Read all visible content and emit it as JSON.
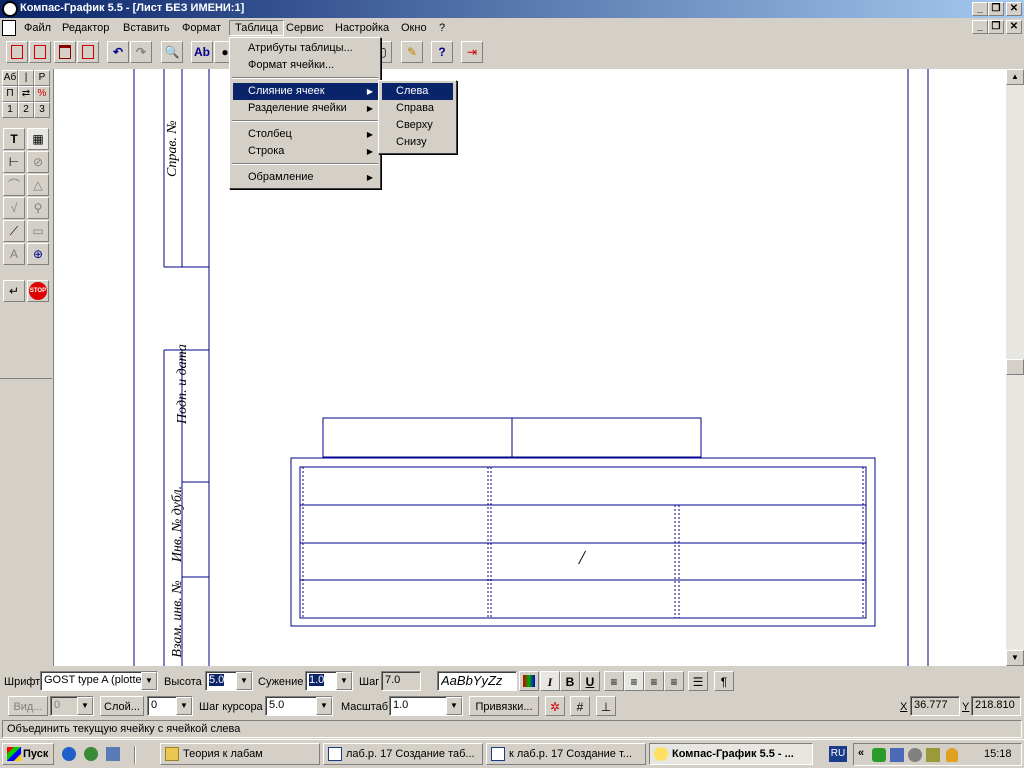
{
  "window": {
    "title": "Компас-График 5.5 - [Лист БЕЗ ИМЕНИ:1]",
    "controls": [
      "_",
      "❐",
      "✕"
    ]
  },
  "menubar": {
    "items": [
      "Файл",
      "Редактор",
      "Вставить",
      "Формат",
      "Таблица",
      "Сервис",
      "Настройка",
      "Окно",
      "?"
    ]
  },
  "table_menu": {
    "items": [
      {
        "label": "Атрибуты таблицы..."
      },
      {
        "label": "Формат ячейки..."
      },
      {
        "label": "Слияние ячеек",
        "submenu": true
      },
      {
        "label": "Разделение ячейки",
        "submenu": true
      },
      {
        "label": "Столбец",
        "submenu": true
      },
      {
        "label": "Строка",
        "submenu": true
      },
      {
        "label": "Обрамление",
        "submenu": true
      }
    ]
  },
  "merge_submenu": {
    "items": [
      "Слева",
      "Справа",
      "Сверху",
      "Снизу"
    ]
  },
  "palette": {
    "row1": [
      "Аб",
      "|↔|",
      "Р"
    ],
    "row2": [
      "П",
      "⇄",
      "%"
    ],
    "row3": [
      "1",
      "2",
      "3"
    ],
    "tools": [
      "T",
      "▦",
      "⊢",
      "⊘",
      "⌒",
      "△",
      "√",
      "⚲",
      "⟋",
      "▭",
      "A",
      "⊕",
      "↵",
      "STOP"
    ]
  },
  "frame_labels": {
    "sprav": "Справ. №",
    "podp": "Подп. и дата",
    "inv_dubl": "Инв. № дубл.",
    "vzam": "Взам. инв. №"
  },
  "table_cell_text": "/",
  "propbar1": {
    "font_label": "Шрифт",
    "font_value": "GOST type A (plotter)",
    "height_label": "Высота",
    "height_value": "5.0",
    "narrow_label": "Сужение",
    "narrow_value": "1.0",
    "step_label": "Шаг",
    "step_value": "7.0",
    "sample": "AaBbYyZz",
    "italic": "I",
    "bold": "B",
    "underline": "U",
    "para": "¶"
  },
  "propbar2": {
    "view_label": "Вид...",
    "view_value": "0",
    "layer_label": "Слой...",
    "layer_value": "0",
    "cursor_step_label": "Шаг курсора",
    "cursor_step_value": "5.0",
    "scale_label": "Масштаб",
    "scale_value": "1.0",
    "snap_label": "Привязки...",
    "x_label": "X",
    "x_value": "36.777",
    "y_label": "Y",
    "y_value": "218.810"
  },
  "status": {
    "text": "Объединить текущую ячейку с ячейкой слева"
  },
  "taskbar": {
    "start": "Пуск",
    "tasks": [
      {
        "label": "Теория к лабам",
        "active": false
      },
      {
        "label": "лаб.р. 17 Создание таб...",
        "active": false
      },
      {
        "label": "к лаб.р. 17 Создание т...",
        "active": false
      },
      {
        "label": "Компас-График 5.5 - ...",
        "active": true
      }
    ],
    "lang": "RU",
    "clock": "15:18",
    "chevron": "«"
  },
  "colors": {
    "title_start": "#0a246a",
    "title_end": "#a6caf0",
    "drawing_line": "#00008b",
    "selection": "#0a246a"
  }
}
